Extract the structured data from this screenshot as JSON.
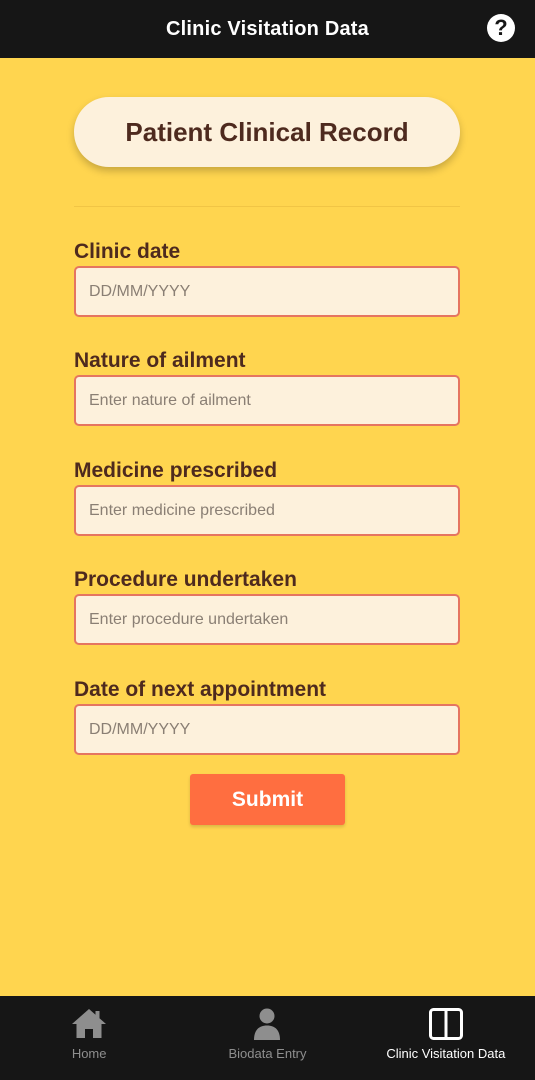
{
  "header": {
    "title": "Clinic Visitation Data",
    "help_icon": "question-circle-icon"
  },
  "form": {
    "heading": "Patient Clinical Record",
    "fields": [
      {
        "label": "Clinic date",
        "placeholder": "DD/MM/YYYY",
        "value": ""
      },
      {
        "label": "Nature of ailment",
        "placeholder": "Enter nature of ailment",
        "value": ""
      },
      {
        "label": "Medicine prescribed",
        "placeholder": "Enter medicine prescribed",
        "value": ""
      },
      {
        "label": "Procedure undertaken",
        "placeholder": "Enter procedure undertaken",
        "value": ""
      },
      {
        "label": "Date of next appointment",
        "placeholder": "DD/MM/YYYY",
        "value": ""
      }
    ],
    "submit_label": "Submit"
  },
  "tabs": [
    {
      "label": "Home",
      "icon": "home-icon",
      "active": false
    },
    {
      "label": "Biodata Entry",
      "icon": "person-icon",
      "active": false
    },
    {
      "label": "Clinic Visitation Data",
      "icon": "columns-icon",
      "active": true
    }
  ],
  "colors": {
    "background": "#FFD54F",
    "bar": "#161616",
    "text_brown": "#4E2A1E",
    "input_fill": "#FDF1DC",
    "input_border": "#E57560",
    "submit": "#FF6E40"
  }
}
